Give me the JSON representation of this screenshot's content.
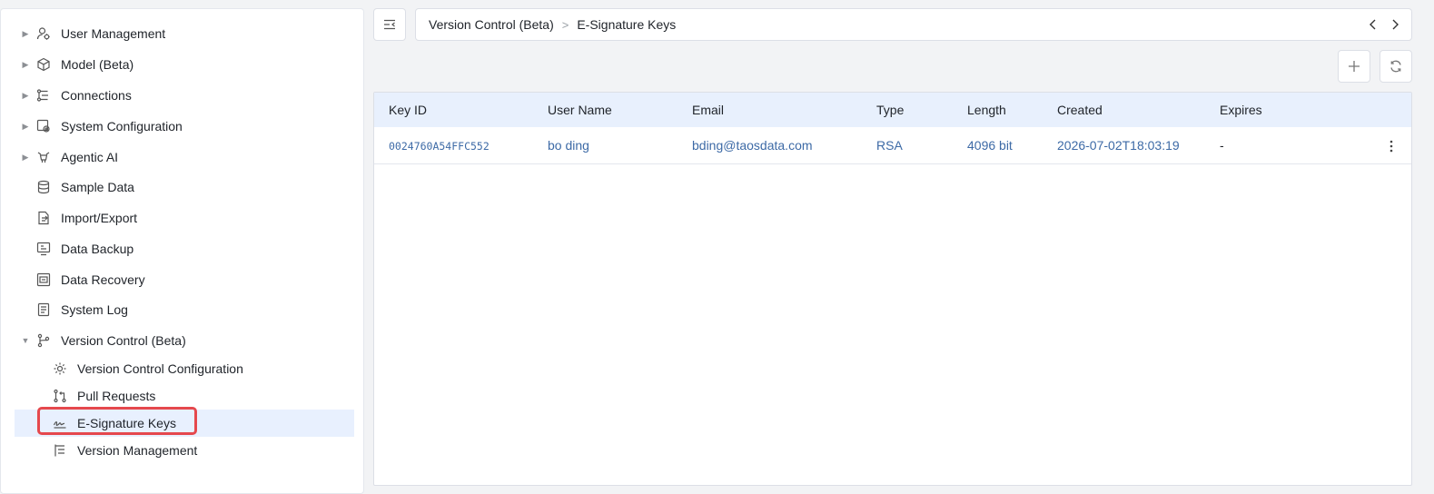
{
  "sidebar": {
    "items": [
      {
        "label": "User Management",
        "icon": "user-management-icon",
        "expandable": true
      },
      {
        "label": "Model (Beta)",
        "icon": "model-cube-icon",
        "expandable": true
      },
      {
        "label": "Connections",
        "icon": "connections-icon",
        "expandable": true
      },
      {
        "label": "System Configuration",
        "icon": "system-config-icon",
        "expandable": true
      },
      {
        "label": "Agentic AI",
        "icon": "agentic-ai-icon",
        "expandable": true
      },
      {
        "label": "Sample Data",
        "icon": "database-icon",
        "expandable": false
      },
      {
        "label": "Import/Export",
        "icon": "import-export-icon",
        "expandable": false
      },
      {
        "label": "Data Backup",
        "icon": "data-backup-icon",
        "expandable": false
      },
      {
        "label": "Data Recovery",
        "icon": "data-recovery-icon",
        "expandable": false
      },
      {
        "label": "System Log",
        "icon": "system-log-icon",
        "expandable": false
      },
      {
        "label": "Version Control (Beta)",
        "icon": "version-control-icon",
        "expandable": true,
        "expanded": true
      }
    ],
    "children": [
      {
        "label": "Version Control Configuration",
        "icon": "gear-icon"
      },
      {
        "label": "Pull Requests",
        "icon": "pull-request-icon"
      },
      {
        "label": "E-Signature Keys",
        "icon": "signature-icon",
        "selected": true
      },
      {
        "label": "Version Management",
        "icon": "version-list-icon"
      }
    ]
  },
  "breadcrumb": {
    "parent": "Version Control (Beta)",
    "separator": ">",
    "current": "E-Signature Keys"
  },
  "table": {
    "headers": [
      "Key ID",
      "User Name",
      "Email",
      "Type",
      "Length",
      "Created",
      "Expires"
    ],
    "rows": [
      {
        "key_id": "0024760A54FFC552",
        "user_name": "bo ding",
        "email": "bding@taosdata.com",
        "type": "RSA",
        "length": "4096 bit",
        "created": "2026-07-02T18:03:19",
        "expires": "-"
      }
    ]
  },
  "colors": {
    "accent": "#3d6aa6",
    "selected_bg": "#e8f0fe",
    "header_bg": "#e8f0fd",
    "highlight": "#e5484d"
  }
}
